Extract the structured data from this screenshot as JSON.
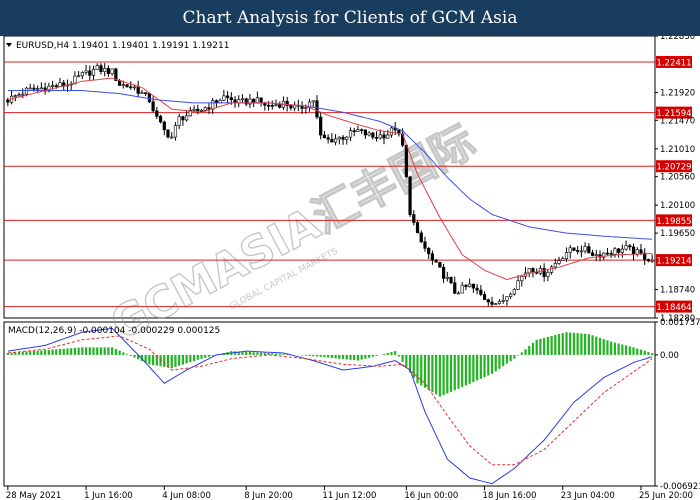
{
  "header": {
    "title": "Chart Analysis for Clients of GCM Asia"
  },
  "main_info": "EURUSD,H4  1.19401 1.19401 1.19191 1.19211",
  "macd_info": "MACD(12,26,9) -0.000104 -0.000229 0.000125",
  "watermark": {
    "brand": "GCMASIA汇丰国际",
    "sub": "GLOBAL CAPITAL MARKETS"
  },
  "colors": {
    "ma_fast": "#e0404a",
    "ma_slow": "#3a4ee8",
    "level_line": "#d62020",
    "level_label_bg": "#d40000",
    "macd_hist": "#22b422",
    "macd_main": "#2a3ce0",
    "macd_signal": "#e03030"
  },
  "chart_data": [
    {
      "type": "candlestick",
      "symbol": "EURUSD",
      "timeframe": "H4",
      "ylim": [
        1.1828,
        1.2283
      ],
      "y_ticks": [
        "1.22830",
        "1.21920",
        "1.21470",
        "1.21010",
        "1.20560",
        "1.20100",
        "1.19650",
        "1.18740",
        "1.18280"
      ],
      "x_labels": [
        "28 May 2021",
        "1 Jun 16:00",
        "4 Jun 08:00",
        "8 Jun 20:00",
        "11 Jun 12:00",
        "16 Jun 00:00",
        "18 Jun 16:00",
        "23 Jun 04:00",
        "25 Jun 20:00"
      ],
      "levels": [
        "1.22411",
        "1.21594",
        "1.20729",
        "1.19855",
        "1.19214",
        "1.18464"
      ],
      "close_path": [
        [
          0,
          1.218
        ],
        [
          5,
          1.2195
        ],
        [
          10,
          1.22
        ],
        [
          16,
          1.2205
        ],
        [
          20,
          1.222
        ],
        [
          24,
          1.223
        ],
        [
          28,
          1.2225
        ],
        [
          30,
          1.2205
        ],
        [
          34,
          1.22
        ],
        [
          38,
          1.218
        ],
        [
          40,
          1.215
        ],
        [
          42,
          1.213
        ],
        [
          44,
          1.212
        ],
        [
          46,
          1.215
        ],
        [
          50,
          1.216
        ],
        [
          54,
          1.217
        ],
        [
          58,
          1.2185
        ],
        [
          62,
          1.2175
        ],
        [
          66,
          1.218
        ],
        [
          70,
          1.217
        ],
        [
          74,
          1.2175
        ],
        [
          78,
          1.2165
        ],
        [
          82,
          1.218
        ],
        [
          84,
          1.212
        ],
        [
          86,
          1.2115
        ],
        [
          90,
          1.212
        ],
        [
          94,
          1.213
        ],
        [
          98,
          1.212
        ],
        [
          102,
          1.2125
        ],
        [
          104,
          1.2135
        ],
        [
          106,
          1.2105
        ],
        [
          108,
          1.2
        ],
        [
          110,
          1.196
        ],
        [
          114,
          1.192
        ],
        [
          118,
          1.189
        ],
        [
          120,
          1.187
        ],
        [
          124,
          1.188
        ],
        [
          128,
          1.186
        ],
        [
          132,
          1.185
        ],
        [
          136,
          1.188
        ],
        [
          140,
          1.191
        ],
        [
          144,
          1.19
        ],
        [
          146,
          1.191
        ],
        [
          150,
          1.1935
        ],
        [
          154,
          1.194
        ],
        [
          158,
          1.193
        ],
        [
          162,
          1.1935
        ],
        [
          166,
          1.194
        ],
        [
          170,
          1.193
        ],
        [
          173,
          1.1921
        ]
      ],
      "ma_fast": [
        [
          0,
          1.218
        ],
        [
          10,
          1.2195
        ],
        [
          20,
          1.221
        ],
        [
          28,
          1.2215
        ],
        [
          36,
          1.22
        ],
        [
          44,
          1.2165
        ],
        [
          52,
          1.216
        ],
        [
          60,
          1.2175
        ],
        [
          70,
          1.2175
        ],
        [
          80,
          1.217
        ],
        [
          86,
          1.2155
        ],
        [
          94,
          1.214
        ],
        [
          100,
          1.213
        ],
        [
          106,
          1.2125
        ],
        [
          110,
          1.206
        ],
        [
          116,
          1.199
        ],
        [
          122,
          1.193
        ],
        [
          128,
          1.1905
        ],
        [
          134,
          1.189
        ],
        [
          140,
          1.19
        ],
        [
          148,
          1.191
        ],
        [
          156,
          1.1925
        ],
        [
          164,
          1.193
        ],
        [
          173,
          1.1932
        ]
      ],
      "ma_slow": [
        [
          0,
          1.2195
        ],
        [
          10,
          1.2195
        ],
        [
          20,
          1.2195
        ],
        [
          30,
          1.219
        ],
        [
          40,
          1.218
        ],
        [
          50,
          1.2175
        ],
        [
          60,
          1.2175
        ],
        [
          70,
          1.2175
        ],
        [
          80,
          1.217
        ],
        [
          90,
          1.216
        ],
        [
          100,
          1.2145
        ],
        [
          106,
          1.213
        ],
        [
          112,
          1.2095
        ],
        [
          118,
          1.2055
        ],
        [
          124,
          1.202
        ],
        [
          130,
          1.1995
        ],
        [
          140,
          1.1975
        ],
        [
          150,
          1.1965
        ],
        [
          160,
          1.196
        ],
        [
          173,
          1.1955
        ]
      ]
    },
    {
      "type": "macd",
      "ylim": [
        -0.006923,
        0.001737
      ],
      "y_ticks": [
        "0.001737",
        "0.00",
        "-0.006923"
      ],
      "params": [
        12,
        26,
        9
      ],
      "values": {
        "main": -0.000104,
        "signal": -0.000229,
        "histogram": 0.000125
      },
      "main_line": [
        [
          0,
          0.0002
        ],
        [
          10,
          0.0005
        ],
        [
          20,
          0.0012
        ],
        [
          28,
          0.0014
        ],
        [
          36,
          -0.0002
        ],
        [
          42,
          -0.0015
        ],
        [
          48,
          -0.0008
        ],
        [
          56,
          0.0
        ],
        [
          64,
          0.0002
        ],
        [
          74,
          0.0001
        ],
        [
          82,
          -0.0003
        ],
        [
          90,
          -0.0008
        ],
        [
          98,
          -0.0006
        ],
        [
          104,
          -0.0003
        ],
        [
          108,
          -0.0008
        ],
        [
          112,
          -0.003
        ],
        [
          118,
          -0.0055
        ],
        [
          124,
          -0.0065
        ],
        [
          130,
          -0.0068
        ],
        [
          136,
          -0.006
        ],
        [
          144,
          -0.0045
        ],
        [
          152,
          -0.0025
        ],
        [
          160,
          -0.0012
        ],
        [
          168,
          -0.0004
        ],
        [
          173,
          -0.0001
        ]
      ],
      "signal_line": [
        [
          0,
          0.0001
        ],
        [
          10,
          0.0003
        ],
        [
          20,
          0.0008
        ],
        [
          30,
          0.001
        ],
        [
          38,
          0.0003
        ],
        [
          44,
          -0.0008
        ],
        [
          52,
          -0.0006
        ],
        [
          60,
          -0.0002
        ],
        [
          70,
          0.0
        ],
        [
          80,
          -0.0002
        ],
        [
          90,
          -0.0005
        ],
        [
          100,
          -0.0006
        ],
        [
          106,
          -0.0005
        ],
        [
          112,
          -0.0015
        ],
        [
          118,
          -0.0032
        ],
        [
          124,
          -0.0048
        ],
        [
          130,
          -0.0058
        ],
        [
          136,
          -0.0058
        ],
        [
          144,
          -0.005
        ],
        [
          152,
          -0.0035
        ],
        [
          160,
          -0.002
        ],
        [
          168,
          -0.0009
        ],
        [
          173,
          -0.0002
        ]
      ],
      "histogram": [
        [
          0,
          0.0001
        ],
        [
          20,
          0.0004
        ],
        [
          28,
          0.0004
        ],
        [
          38,
          -0.0005
        ],
        [
          44,
          -0.0007
        ],
        [
          52,
          -0.0002
        ],
        [
          60,
          0.0002
        ],
        [
          70,
          0.0001
        ],
        [
          84,
          -0.0001
        ],
        [
          94,
          -0.0003
        ],
        [
          104,
          0.0002
        ],
        [
          110,
          -0.0015
        ],
        [
          116,
          -0.0022
        ],
        [
          122,
          -0.0017
        ],
        [
          130,
          -0.001
        ],
        [
          136,
          -0.0002
        ],
        [
          142,
          0.0008
        ],
        [
          150,
          0.0012
        ],
        [
          156,
          0.0011
        ],
        [
          162,
          0.0007
        ],
        [
          168,
          0.0004
        ],
        [
          173,
          0.0001
        ]
      ]
    }
  ]
}
